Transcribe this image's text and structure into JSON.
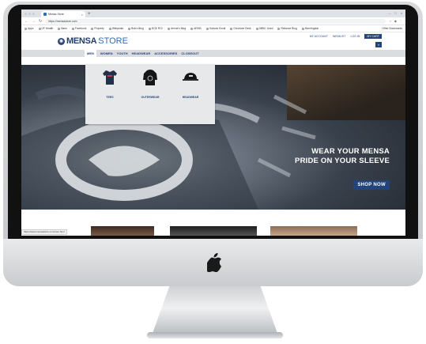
{
  "browser": {
    "tab_title": "Mensa Store",
    "tab_close": "×",
    "new_tab": "+",
    "url": "https://mensastore.com",
    "bookmarks": [
      "Apps",
      "UF Health",
      "Bank",
      "Facebook",
      "Property",
      "Wikipedia",
      "Bob's Blog",
      "DOE ROI",
      "Jennie's Blog",
      "ARMS",
      "Outlook Email",
      "Chronicle Desk",
      "DBBC Used",
      "Reliance Blog",
      "Morningstar"
    ],
    "other_bookmarks": "Other Bookmarks"
  },
  "site": {
    "logo_mensa": "MENSA",
    "logo_store": "STORE",
    "utility_links": [
      "MY ACCOUNT",
      "WISHLIST",
      "LOG IN"
    ],
    "cart_label": "MY CART",
    "nav_items": [
      "MEN",
      "WOMEN",
      "YOUTH",
      "HEADWEAR",
      "ACCESSORIES",
      "CLOSEOUT"
    ],
    "mega_menu": [
      "TEES",
      "OUTERWEAR",
      "HEADWEAR"
    ],
    "hero_heading_line1": "WEAR YOUR MENSA",
    "hero_heading_line2": "PRIDE ON YOUR SLEEVE",
    "hero_button": "SHOP NOW",
    "status_url": "https://www.mensastore.com/men.html"
  },
  "colors": {
    "brand_navy": "#23447a",
    "brand_blue": "#2c6fb7"
  },
  "icons": [
    "apple-logo-icon",
    "search-icon",
    "tee-icon",
    "hoodie-icon",
    "cap-icon"
  ]
}
